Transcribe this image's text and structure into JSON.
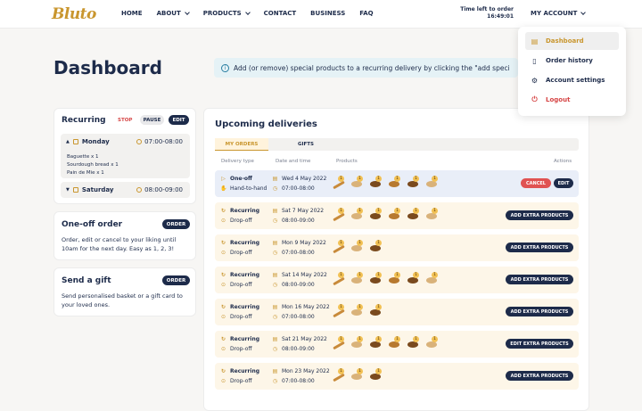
{
  "header": {
    "logo": "Bluto",
    "nav": [
      {
        "label": "HOME",
        "dropdown": false
      },
      {
        "label": "ABOUT",
        "dropdown": true
      },
      {
        "label": "PRODUCTS",
        "dropdown": true
      },
      {
        "label": "CONTACT",
        "dropdown": false
      },
      {
        "label": "BUSINESS",
        "dropdown": false
      },
      {
        "label": "FAQ",
        "dropdown": false
      }
    ],
    "time_left_label": "Time left to order",
    "time_left_value": "16:49:01",
    "account_label": "MY ACCOUNT"
  },
  "account_menu": {
    "items": [
      {
        "label": "Dashboard",
        "icon": "calendar-icon",
        "active": true
      },
      {
        "label": "Order history",
        "icon": "document-icon",
        "active": false
      },
      {
        "label": "Account settings",
        "icon": "gear-icon",
        "active": false
      },
      {
        "label": "Logout",
        "icon": "power-icon",
        "active": false
      }
    ]
  },
  "page": {
    "title": "Dashboard",
    "info": "Add (or remove) special products to a recurring delivery by clicking the \"add speci"
  },
  "recurring": {
    "title": "Recurring",
    "stop_label": "STOP",
    "pause_label": "PAUSE",
    "edit_label": "EDIT",
    "days": [
      {
        "day": "Monday",
        "time": "07:00-08:00",
        "expanded": true,
        "items": [
          "Baguette x 1",
          "Sourdough bread x 1",
          "Pain de Mie x 1"
        ]
      },
      {
        "day": "Saturday",
        "time": "08:00-09:00",
        "expanded": false,
        "items": []
      }
    ]
  },
  "oneoff": {
    "title": "One-off order",
    "button": "ORDER",
    "text": "Order, edit or cancel to your liking until 10am for the next day. Easy as 1, 2, 3!"
  },
  "gift": {
    "title": "Send a gift",
    "button": "ORDER",
    "text": "Send personalised basket or a gift card to your loved ones."
  },
  "deliveries": {
    "title": "Upcoming deliveries",
    "tabs": [
      "MY ORDERS",
      "GIFTS"
    ],
    "columns": [
      "Delivery type",
      "Date and time",
      "Products",
      "Actions"
    ],
    "rows": [
      {
        "type": "One-off",
        "method": "Hand-to-hand",
        "date": "Wed 4 May 2022",
        "time": "07:00-08:00",
        "products": 6,
        "actions": [
          "CANCEL",
          "EDIT"
        ],
        "style": "one"
      },
      {
        "type": "Recurring",
        "method": "Drop-off",
        "date": "Sat 7 May 2022",
        "time": "08:00-09:00",
        "products": 6,
        "actions": [
          "ADD EXTRA PRODUCTS"
        ],
        "style": "rec"
      },
      {
        "type": "Recurring",
        "method": "Drop-off",
        "date": "Mon 9 May 2022",
        "time": "07:00-08:00",
        "products": 3,
        "actions": [
          "ADD EXTRA PRODUCTS"
        ],
        "style": "rec"
      },
      {
        "type": "Recurring",
        "method": "Drop-off",
        "date": "Sat 14 May 2022",
        "time": "08:00-09:00",
        "products": 6,
        "actions": [
          "ADD EXTRA PRODUCTS"
        ],
        "style": "rec"
      },
      {
        "type": "Recurring",
        "method": "Drop-off",
        "date": "Mon 16 May 2022",
        "time": "07:00-08:00",
        "products": 3,
        "actions": [
          "ADD EXTRA PRODUCTS"
        ],
        "style": "rec"
      },
      {
        "type": "Recurring",
        "method": "Drop-off",
        "date": "Sat 21 May 2022",
        "time": "08:00-09:00",
        "products": 6,
        "actions": [
          "EDIT EXTRA PRODUCTS"
        ],
        "style": "rec"
      },
      {
        "type": "Recurring",
        "method": "Drop-off",
        "date": "Mon 23 May 2022",
        "time": "07:00-08:00",
        "products": 3,
        "actions": [
          "ADD EXTRA PRODUCTS"
        ],
        "style": "rec"
      }
    ]
  },
  "colors": {
    "navy": "#1d2b4a",
    "gold": "#c9962e",
    "red": "#e05252",
    "info_bg": "#e5f2f6"
  }
}
